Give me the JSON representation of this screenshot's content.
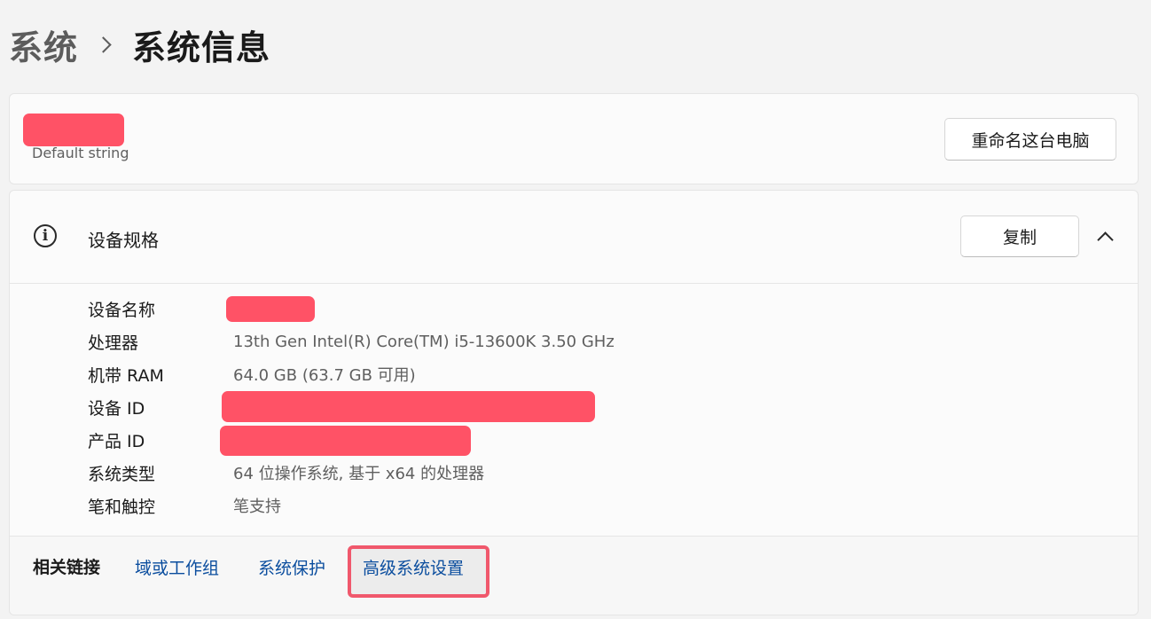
{
  "breadcrumb": {
    "parent": "系统",
    "current": "系统信息"
  },
  "pc_card": {
    "subtitle": "Default string",
    "rename_button": "重命名这台电脑"
  },
  "specs": {
    "title": "设备规格",
    "copy_button": "复制",
    "rows": [
      {
        "label": "设备名称",
        "value": ""
      },
      {
        "label": "处理器",
        "value": "13th Gen Intel(R) Core(TM) i5-13600K   3.50 GHz"
      },
      {
        "label": "机带 RAM",
        "value": "64.0 GB (63.7 GB 可用)"
      },
      {
        "label": "设备 ID",
        "value": ""
      },
      {
        "label": "产品 ID",
        "value": ""
      },
      {
        "label": "系统类型",
        "value": "64 位操作系统, 基于 x64 的处理器"
      },
      {
        "label": "笔和触控",
        "value": "笔支持"
      }
    ]
  },
  "related": {
    "label": "相关链接",
    "links": [
      "域或工作组",
      "系统保护",
      "高级系统设置"
    ]
  },
  "colors": {
    "accent_link": "#0a4d9e",
    "redaction": "#ff5266",
    "highlight": "#f0586c"
  }
}
